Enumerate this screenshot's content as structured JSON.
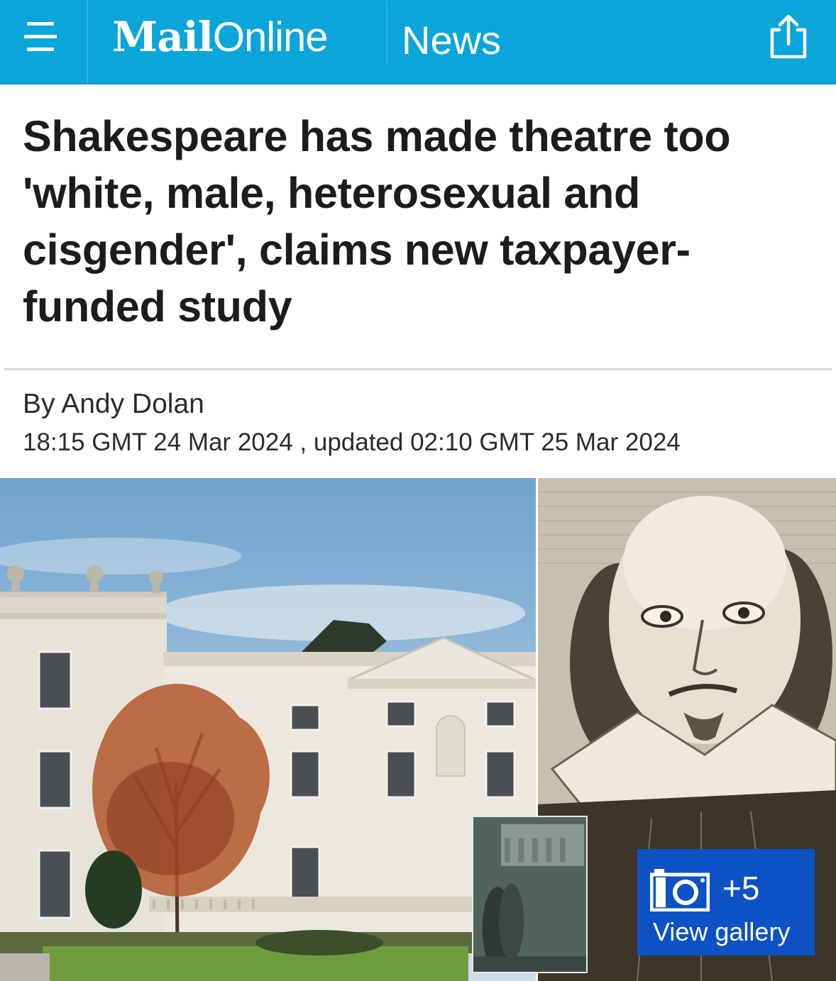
{
  "header": {
    "logo_mail": "Mail",
    "logo_online": "Online",
    "channel": "News",
    "brand_color": "#0aa5d9"
  },
  "article": {
    "headline": "Shakespeare has made theatre too 'white, male, heterosexual and cisgender', claims new taxpayer-funded study",
    "byline_prefix": "By",
    "author": "Andy Dolan",
    "dateline": "18:15 GMT 24 Mar 2024 , updated 02:10 GMT 25 Mar 2024"
  },
  "gallery": {
    "count": "+5",
    "label": "View gallery",
    "icon": "camera-icon",
    "button_color": "#0d52c4"
  }
}
